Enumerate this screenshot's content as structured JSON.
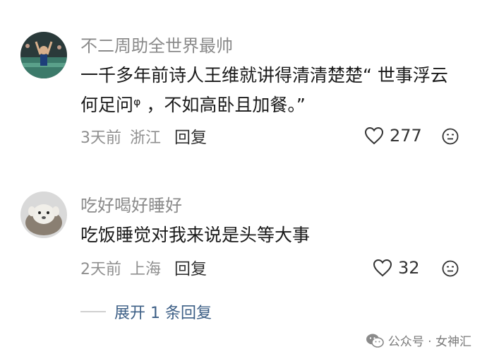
{
  "comments": [
    {
      "username": "不二周助全世界最帅",
      "text_line1": "一千多年前诗人王维就讲得清清楚楚“ 世事浮云",
      "text_line2": "何足问ᵠ ，不如高卧且加餐。”",
      "time": "3天前",
      "location": "浙江",
      "reply_label": "回复",
      "likes": "277"
    },
    {
      "username": "吃好喝好睡好",
      "text_line1": "吃饭睡觉对我来说是头等大事",
      "time": "2天前",
      "location": "上海",
      "reply_label": "回复",
      "likes": "32"
    }
  ],
  "expand_replies": "展开 1 条回复",
  "watermark": "公众号 · 女神汇",
  "icons": {
    "like": "heart-outline-icon",
    "emoji": "emoji-face-icon",
    "watermark": "wechat-logo-icon"
  }
}
